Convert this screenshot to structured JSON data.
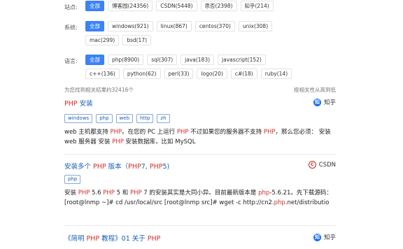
{
  "filters": {
    "site": {
      "label": "站点:",
      "options": [
        "全部",
        "博客园(24356)",
        "CSDN(5448)",
        "思否(2398)",
        "知乎(214)"
      ]
    },
    "system": {
      "label": "系统:",
      "options": [
        "全部",
        "windows(921)",
        "linux(867)",
        "centos(370)",
        "unix(308)",
        "mac(299)",
        "bsd(17)"
      ]
    },
    "language": {
      "label": "语言:",
      "options": [
        "全部",
        "php(8900)",
        "sql(307)",
        "java(183)",
        "javascript(152)",
        "c++(136)",
        "python(62)",
        "perl(33)",
        "logo(20)",
        "c#(18)",
        "ruby(14)"
      ]
    }
  },
  "meta": {
    "count_text": "为您找到相关结果约32416个",
    "sort_text": "按相关性从高到低"
  },
  "results": [
    {
      "title_hl": "PHP",
      "title_rest": " 安装",
      "source": "知乎",
      "tags": [
        "windows",
        "php",
        "web",
        "http",
        "zh"
      ],
      "snippet_parts": [
        {
          "t": "web 主机都支持 ",
          "hl": false
        },
        {
          "t": "PHP",
          "hl": true
        },
        {
          "t": "。在您的 PC 上运行 ",
          "hl": false
        },
        {
          "t": "PHP",
          "hl": true
        },
        {
          "t": " 不过如果您的服务器不支持 ",
          "hl": false
        },
        {
          "t": "PHP",
          "hl": true
        },
        {
          "t": "，那么您必须： 安装 web 服务器 安装 ",
          "hl": false
        },
        {
          "t": "PHP",
          "hl": true
        },
        {
          "t": " 安装数据库，比如 MySQL",
          "hl": false
        }
      ]
    },
    {
      "title_parts": [
        {
          "t": "安装多个 ",
          "hl": false
        },
        {
          "t": "PHP",
          "hl": true
        },
        {
          "t": " 版本（",
          "hl": false
        },
        {
          "t": "PHP",
          "hl": true
        },
        {
          "t": "7, ",
          "hl": false
        },
        {
          "t": "PHP",
          "hl": true
        },
        {
          "t": "5)",
          "hl": false
        }
      ],
      "source": "CSDN",
      "tags": [
        "php"
      ],
      "snippet_parts": [
        {
          "t": "安装 ",
          "hl": false
        },
        {
          "t": "PHP",
          "hl": true
        },
        {
          "t": " 5.6 ",
          "hl": false
        },
        {
          "t": "PHP",
          "hl": true
        },
        {
          "t": " 5 和 ",
          "hl": false
        },
        {
          "t": "PHP",
          "hl": true
        },
        {
          "t": " 7 的安装其实是大同小异。目前最新版本是 ",
          "hl": false
        },
        {
          "t": "php",
          "hl": true
        },
        {
          "t": "-5.6.21。先下载源码： [root@lnmp ~]# cd /usr/local/src [root@lnmp src]# wget -c http://cn2.",
          "hl": false
        },
        {
          "t": "php",
          "hl": true
        },
        {
          "t": ".net/distributio",
          "hl": false
        }
      ]
    },
    {
      "title_parts": [
        {
          "t": "《简明 ",
          "hl": false
        },
        {
          "t": "PHP",
          "hl": true
        },
        {
          "t": " 教程》01 关于 ",
          "hl": false
        },
        {
          "t": "PHP",
          "hl": true
        }
      ],
      "source": "知乎"
    }
  ]
}
